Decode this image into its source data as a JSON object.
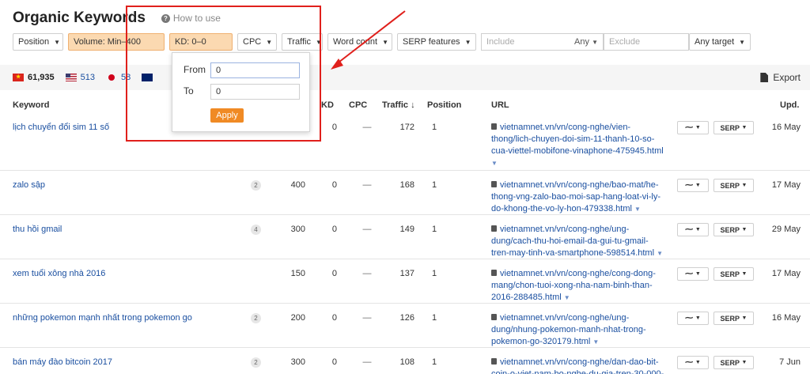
{
  "header": {
    "title": "Organic Keywords",
    "how_to": "How to use"
  },
  "filters": {
    "position": "Position",
    "volume": "Volume: Min–400",
    "kd": "KD: 0–0",
    "cpc": "CPC",
    "traffic": "Traffic",
    "word_count": "Word count",
    "serp_features": "SERP features",
    "include_placeholder": "Include",
    "include_any": "Any",
    "exclude_placeholder": "Exclude",
    "any_target": "Any target"
  },
  "countries": [
    {
      "flag": "vn",
      "count": "61,935"
    },
    {
      "flag": "us",
      "count": "513"
    },
    {
      "flag": "jp",
      "count": "58"
    },
    {
      "flag": "au",
      "count": ""
    }
  ],
  "export_label": "Export",
  "popup": {
    "from_label": "From",
    "from_value": "0",
    "to_label": "To",
    "to_value": "0",
    "apply_label": "Apply"
  },
  "columns": {
    "keyword": "Keyword",
    "kd": "KD",
    "cpc": "CPC",
    "traffic": "Traffic ↓",
    "position": "Position",
    "url": "URL",
    "updated": "Upd."
  },
  "rows": [
    {
      "keyword": "lịch chuyển đổi sim 11 số",
      "serp_features": "",
      "volume": "",
      "kd": "0",
      "cpc": "—",
      "traffic": "172",
      "position": "1",
      "url_lines": [
        "vietnamnet.vn/vn/cong-nghe/vien-",
        "thong/lich-chuyen-doi-sim-11-thanh-10-so-",
        "cua-viettel-mobifone-vinaphone-475945.html"
      ],
      "trend": "~",
      "serp": "SERP",
      "updated": "16 May"
    },
    {
      "keyword": "zalo sập",
      "serp_features": "2",
      "volume": "400",
      "kd": "0",
      "cpc": "—",
      "traffic": "168",
      "position": "1",
      "url_lines": [
        "vietnamnet.vn/vn/cong-nghe/bao-mat/he-",
        "thong-vng-zalo-bao-moi-sap-hang-loat-vi-ly-",
        "do-khong-the-vo-ly-hon-479338.html"
      ],
      "trend": "~",
      "serp": "SERP",
      "updated": "17 May"
    },
    {
      "keyword": "thu hồi gmail",
      "serp_features": "4",
      "volume": "300",
      "kd": "0",
      "cpc": "—",
      "traffic": "149",
      "position": "1",
      "url_lines": [
        "vietnamnet.vn/vn/cong-nghe/ung-",
        "dung/cach-thu-hoi-email-da-gui-tu-gmail-",
        "tren-may-tinh-va-smartphone-598514.html"
      ],
      "trend": "~",
      "serp": "SERP",
      "updated": "29 May"
    },
    {
      "keyword": "xem tuổi xông nhà 2016",
      "serp_features": "",
      "volume": "150",
      "kd": "0",
      "cpc": "—",
      "traffic": "137",
      "position": "1",
      "url_lines": [
        "vietnamnet.vn/vn/cong-nghe/cong-dong-",
        "mang/chon-tuoi-xong-nha-nam-binh-than-",
        "2016-288485.html"
      ],
      "trend": "~",
      "serp": "SERP",
      "updated": "17 May"
    },
    {
      "keyword": "những pokemon mạnh nhất trong pokemon go",
      "serp_features": "2",
      "volume": "200",
      "kd": "0",
      "cpc": "—",
      "traffic": "126",
      "position": "1",
      "url_lines": [
        "vietnamnet.vn/vn/cong-nghe/ung-",
        "dung/nhung-pokemon-manh-nhat-trong-",
        "pokemon-go-320179.html"
      ],
      "trend": "~",
      "serp": "SERP",
      "updated": "16 May"
    },
    {
      "keyword": "bán máy đào bitcoin 2017",
      "serp_features": "2",
      "volume": "300",
      "kd": "0",
      "cpc": "—",
      "traffic": "108",
      "position": "1",
      "url_lines": [
        "vietnamnet.vn/vn/cong-nghe/dan-dao-bit-",
        "coin-o-viet-nam-bo-nghe-du-gia-tren-30-000-"
      ],
      "trend": "~",
      "serp": "SERP",
      "updated": "7 Jun"
    }
  ]
}
